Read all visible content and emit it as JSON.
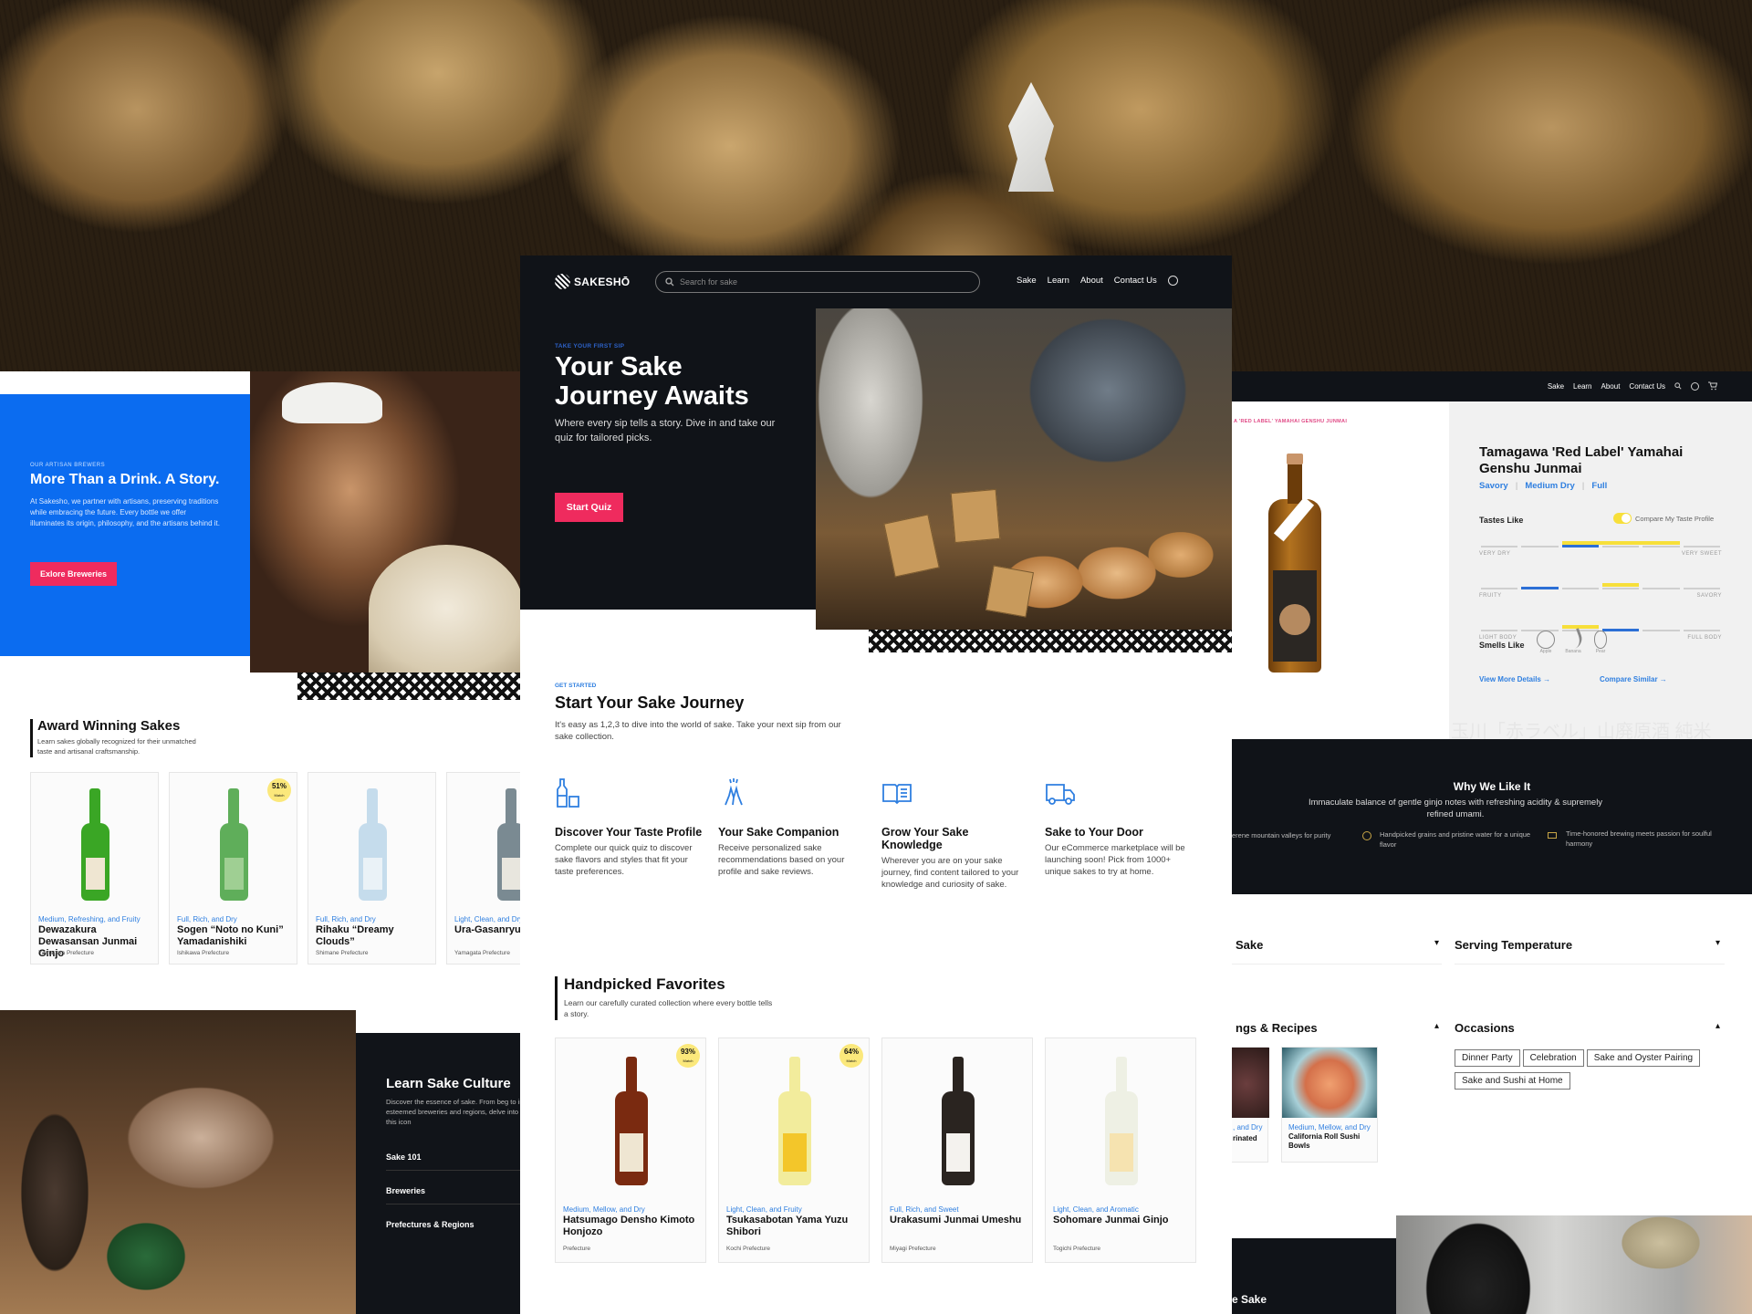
{
  "center": {
    "nav": {
      "logo": "SAKESHŌ",
      "search_placeholder": "Search for sake",
      "links": [
        "Sake",
        "Learn",
        "About",
        "Contact Us"
      ]
    },
    "hero": {
      "eyebrow": "TAKE YOUR FIRST SIP",
      "title_line1": "Your Sake",
      "title_line2": "Journey Awaits",
      "subtitle": "Where every sip tells a story. Dive in and take our quiz for tailored picks.",
      "cta": "Start Quiz"
    },
    "journey": {
      "eyebrow": "GET STARTED",
      "title": "Start Your Sake Journey",
      "subtitle": "It's easy as 1,2,3 to dive into the world of sake. Take your next sip from our sake collection.",
      "features": [
        {
          "icon": "bottle-glass-icon",
          "title": "Discover Your Taste Profile",
          "text": "Complete our quick quiz to discover sake flavors and styles that fit your taste preferences."
        },
        {
          "icon": "cheers-hands-icon",
          "title": "Your Sake Companion",
          "text": "Receive personalized sake recommendations based on your profile and sake reviews."
        },
        {
          "icon": "open-book-icon",
          "title": "Grow Your Sake Knowledge",
          "text": "Wherever you are on your sake journey, find content tailored to your knowledge and curiosity of sake."
        },
        {
          "icon": "delivery-truck-icon",
          "title": "Sake to Your Door",
          "text": "Our eCommerce marketplace will be launching soon! Pick from 1000+ unique sakes to try at home."
        }
      ]
    },
    "favorites": {
      "title": "Handpicked Favorites",
      "subtitle": "Learn our carefully curated collection where every bottle tells a story.",
      "cards": [
        {
          "tag": "Medium, Mellow, and Dry",
          "name": "Hatsumago Densho Kimoto Honjozo",
          "prefecture": "Prefecture",
          "match": "93%",
          "match_label": "Match",
          "bottle_color": "#7a2a10",
          "label_color": "#efe6d2"
        },
        {
          "tag": "Light, Clean, and Fruity",
          "name": "Tsukasabotan Yama Yuzu Shibori",
          "prefecture": "Kochi Prefecture",
          "match": "64%",
          "match_label": "Match",
          "bottle_color": "#f2ec9c",
          "label_color": "#f3c62a"
        },
        {
          "tag": "Full, Rich, and Sweet",
          "name": "Urakasumi Junmai Umeshu",
          "prefecture": "Miyagi Prefecture",
          "match": null,
          "bottle_color": "#2a2420",
          "label_color": "#f4f2ee"
        },
        {
          "tag": "Light, Clean, and Aromatic",
          "name": "Sohomare Junmai Ginjo",
          "prefecture": "Togichi Prefecture",
          "match": null,
          "bottle_color": "#eef0e4",
          "label_color": "#f6e3b0"
        }
      ]
    }
  },
  "left": {
    "brewers": {
      "eyebrow": "OUR ARTISAN BREWERS",
      "title": "More Than a Drink. A Story.",
      "text": "At Sakesho, we partner with artisans, preserving traditions while embracing the future. Every bottle we offer illuminates its origin, philosophy, and the artisans behind it.",
      "cta": "Exlore Breweries"
    },
    "awards": {
      "title": "Award Winning Sakes",
      "subtitle": "Learn sakes globally recognized for their unmatched taste and artisanal craftsmanship.",
      "cards": [
        {
          "tag": "Medium, Refreshing, and Fruity",
          "name": "Dewazakura Dewasansan Junmai Ginjo",
          "prefecture": "Yamagata Prefecture",
          "match": null,
          "bottle_color": "#3aa625",
          "label_color": "#efe6d2"
        },
        {
          "tag": "Full, Rich, and Dry",
          "name": "Sogen “Noto no Kuni” Yamadanishiki",
          "prefecture": "Ishikawa Prefecture",
          "match": "51%",
          "match_label": "Match",
          "bottle_color": "#5fae5a",
          "label_color": "#9fcf93"
        },
        {
          "tag": "Full, Rich, and Dry",
          "name": "Rihaku “Dreamy Clouds”",
          "prefecture": "Shimane Prefecture",
          "match": null,
          "bottle_color": "#c5dcec",
          "label_color": "#eaf2f7"
        },
        {
          "tag": "Light, Clean, and Dry",
          "name": "Ura-Gasanryu",
          "prefecture": "Yamagata Prefecture",
          "match": null,
          "bottle_color": "#7a8a92",
          "label_color": "#e8e6de"
        }
      ]
    },
    "culture": {
      "title": "Learn Sake Culture",
      "text": "Discover the essence of sake. From beg to insights on esteemed breweries and regions, delve into the world of this icon",
      "links": [
        "Sake 101",
        "Breweries",
        "Prefectures & Regions"
      ]
    }
  },
  "right": {
    "nav": {
      "links": [
        "Sake",
        "Learn",
        "About",
        "Contact Us"
      ]
    },
    "product": {
      "breadcrumb": "A 'RED LABEL' YAMAHAI GENSHU JUNMAI",
      "title": "Tamagawa 'Red Label' Yamahai Genshu Junmai",
      "attributes": [
        "Savory",
        "Medium Dry",
        "Full"
      ],
      "tastes_title": "Tastes Like",
      "compare_toggle_label": "Compare My Taste Profile",
      "compare_toggle_on": true,
      "taste_scales": [
        {
          "left": "VERY DRY",
          "right": "VERY SWEET",
          "sake_segment": 3,
          "user_range": [
            3,
            5
          ]
        },
        {
          "left": "FRUITY",
          "right": "SAVORY",
          "sake_segment": 2,
          "user_range": [
            4,
            4
          ]
        },
        {
          "left": "LIGHT BODY",
          "right": "FULL BODY",
          "sake_segment": 4,
          "user_range": [
            3,
            3
          ]
        }
      ],
      "smells_title": "Smells Like",
      "smells": [
        {
          "icon": "apple-icon",
          "label": "Apple"
        },
        {
          "icon": "banana-icon",
          "label": "Banana"
        },
        {
          "icon": "pear-icon",
          "label": "Pear"
        }
      ],
      "view_more": "View More Details →",
      "compare_similar": "Compare Similar →",
      "watermark": "玉川「赤ラベル」山廃原酒 純米"
    },
    "why": {
      "title": "Why We Like It",
      "text": "Immaculate balance of gentle ginjo notes with refreshing acidity & supremely refined umami.",
      "points": [
        {
          "icon": "mountain-icon",
          "text": "erene mountain valleys for purity"
        },
        {
          "icon": "rice-bowl-icon",
          "text": "Handpicked grains and pristine water for a unique flavor"
        },
        {
          "icon": "brewing-icon",
          "text": "Time-honored brewing meets passion for soulful harmony"
        }
      ]
    },
    "accordions": {
      "sake": "Sake",
      "serving": "Serving Temperature",
      "pairings": "ngs & Recipes",
      "occasions": "Occasions",
      "occasion_chips": [
        "Dinner Party",
        "Celebration",
        "Sake and Oyster Pairing",
        "Sake and Sushi at Home"
      ],
      "recipes": [
        {
          "tag": ", and Dry",
          "name": "rinated"
        },
        {
          "tag": "Medium, Mellow, and Dry",
          "name": "California Roll Sushi Bowls"
        }
      ]
    },
    "bottom_title": "e Sake"
  },
  "colors": {
    "accent_blue": "#2f7fe0",
    "brand_blue": "#0b6cf0",
    "cta_pink": "#ef2b5e",
    "dark": "#101318",
    "match_yellow": "#fbe87b",
    "toggle_yellow": "#f7df3a"
  }
}
